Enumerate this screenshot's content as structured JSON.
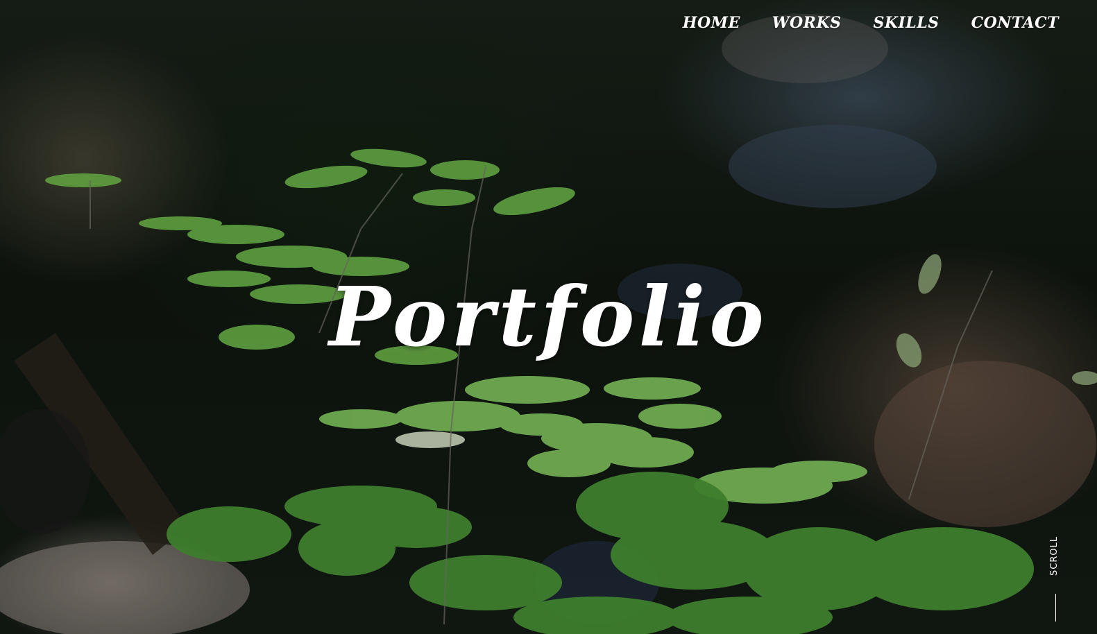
{
  "nav": {
    "items": [
      {
        "label": "HOME"
      },
      {
        "label": "WORKS"
      },
      {
        "label": "SKILLS"
      },
      {
        "label": "CONTACT"
      }
    ]
  },
  "hero": {
    "title": "Portfolio",
    "background": "forest-stream-leaves-photo"
  },
  "scroll": {
    "label": "SCROLL"
  },
  "colors": {
    "text": "#ffffff",
    "leaf": "#6fbf4a",
    "background": "#101710"
  }
}
